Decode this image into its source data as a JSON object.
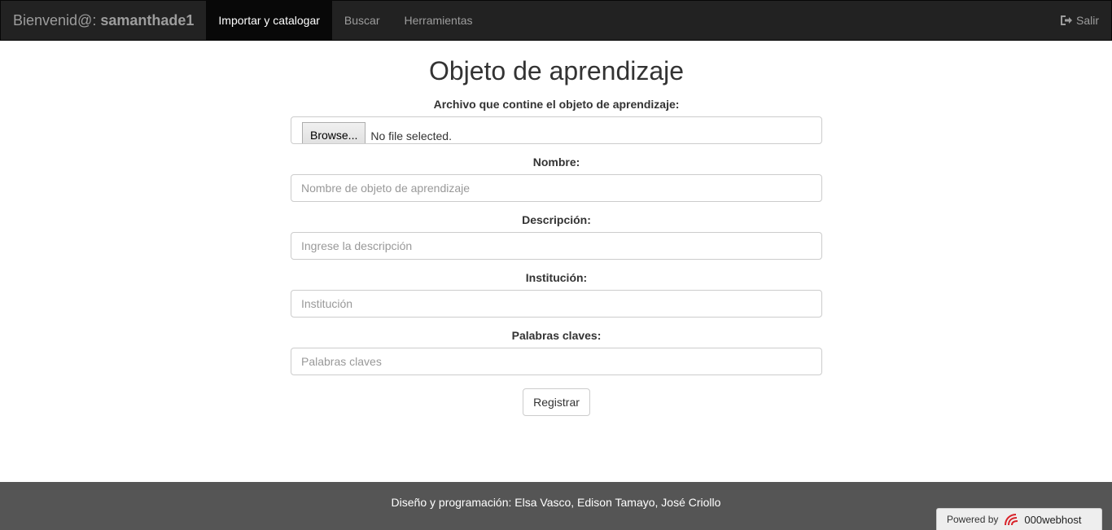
{
  "navbar": {
    "brand_prefix": "Bienvenid@:",
    "username": "samanthade1",
    "items": [
      {
        "label": "Importar y catalogar",
        "active": true
      },
      {
        "label": "Buscar",
        "active": false
      },
      {
        "label": "Herramientas",
        "active": false
      }
    ],
    "logout_label": "Salir",
    "logout_icon": "sign-out-icon"
  },
  "form": {
    "title": "Objeto de aprendizaje",
    "file_label": "Archivo que contine el objeto de aprendizaje:",
    "file_button": "Browse...",
    "file_status": "No file selected.",
    "name_label": "Nombre:",
    "name_placeholder": "Nombre de objeto de aprendizaje",
    "description_label": "Descripción:",
    "description_placeholder": "Ingrese la descripción",
    "institution_label": "Institución:",
    "institution_placeholder": "Institución",
    "keywords_label": "Palabras claves:",
    "keywords_placeholder": "Palabras claves",
    "submit_label": "Registrar"
  },
  "footer": {
    "credits": "Diseño y programación: Elsa Vasco, Edison Tamayo, José Criollo",
    "powered_by": "Powered by",
    "host_name": "000webhost"
  },
  "colors": {
    "navbar_bg": "#222222",
    "navbar_active": "#080808",
    "footer_bg": "#555555",
    "host_logo": "#d8232a"
  }
}
